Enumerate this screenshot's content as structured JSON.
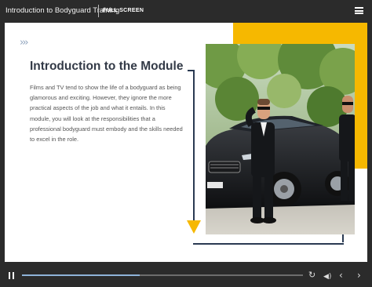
{
  "topbar": {
    "course_title": "Introduction to Bodyguard Training",
    "fullscreen_label": "FULL SCREEN"
  },
  "slide": {
    "chevrons": "›››",
    "title": "Introduction to the Module",
    "body": "Films and TV tend to show the life of a bodyguard as being glamorous and exciting. However, they ignore the more practical aspects of the job and what it entails. In this module, you will look at the responsibilities that a professional bodyguard must embody and the skills needed to excel in the role.",
    "photo_icon": "bodyguards-with-car-photo"
  },
  "player": {
    "progress": 0.42,
    "icons": [
      "pause-icon",
      "replay-icon",
      "volume-icon",
      "chevron-left-icon",
      "chevron-right-icon"
    ],
    "replay_glyph": "↻",
    "volume_glyph": "◀)",
    "prev_glyph": "‹",
    "next_glyph": "›"
  },
  "colors": {
    "accent_yellow": "#f6b800",
    "frame_navy": "#2a3a52",
    "bar_dark": "#2b2b2b",
    "title_text": "#333a47"
  }
}
